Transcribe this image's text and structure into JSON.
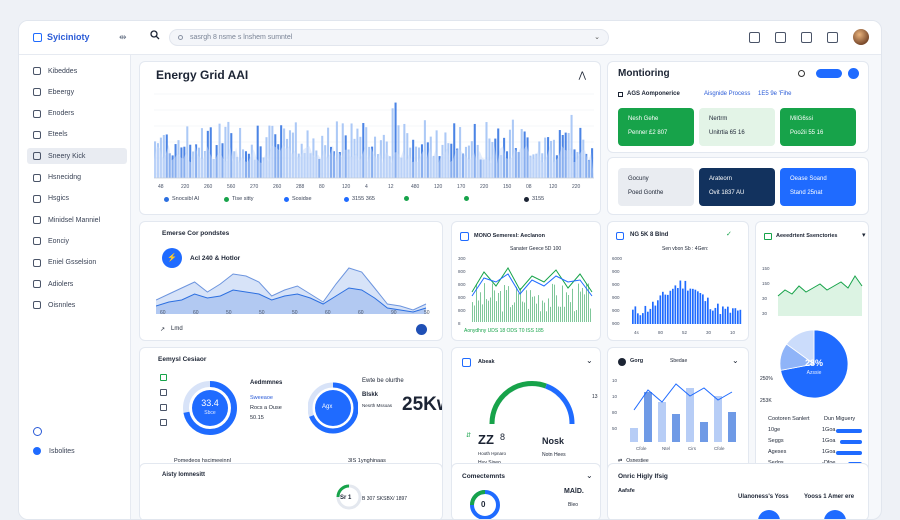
{
  "app": {
    "brand": "Syicinioty"
  },
  "search": {
    "placeholder": "sasrgh 8 nsme s lnshem sumntel"
  },
  "sidebar": {
    "items": [
      {
        "label": "Kibeddes",
        "active": false
      },
      {
        "label": "Ebeergy",
        "active": false
      },
      {
        "label": "Enoders",
        "active": false
      },
      {
        "label": "Eteels",
        "active": false
      },
      {
        "label": "Sneery Kick",
        "active": true
      },
      {
        "label": "Hsnecidng",
        "active": false
      },
      {
        "label": "Hsgics",
        "active": false
      },
      {
        "label": "Minidsel Manniel",
        "active": false
      },
      {
        "label": "Eonciy",
        "active": false
      },
      {
        "label": "Eniel Gsselsion",
        "active": false
      },
      {
        "label": "Adiolers",
        "active": false
      },
      {
        "label": "Oisnnles",
        "active": false
      }
    ],
    "bottom_label": "Isbolites"
  },
  "energy_card": {
    "title": "Energy Grid AAI",
    "x_ticks": [
      "48",
      "220",
      "260",
      "560",
      "270",
      "260",
      "288",
      "80",
      "120",
      "4",
      "12",
      "480",
      "120",
      "170",
      "220",
      "150",
      "08",
      "120",
      "220"
    ],
    "legend": [
      {
        "label": "Snocsibl AI",
        "color": "#2c6fe0"
      },
      {
        "label": "Tise sitty",
        "color": "#17a34a"
      },
      {
        "label": "Sosidse",
        "color": "#1f6bff"
      },
      {
        "label": "3155 365",
        "color": "#1f6bff"
      },
      {
        "label": "",
        "color": "#17a34a"
      },
      {
        "label": "",
        "color": "#17a34a"
      },
      {
        "label": "3155",
        "color": "#1c2434"
      }
    ]
  },
  "monitoring": {
    "title": "Montioring",
    "button_label": "",
    "sub1": "AGS Aomponerice",
    "sub2": "Aisgnide Process",
    "sub3": "1E5 9e 'Fihe",
    "tiles_row1": [
      {
        "l1": "Nesh Gehe",
        "l2": "Penner £2 807"
      },
      {
        "l1": "Nertrm",
        "l2": "Unitrtia 65 16"
      },
      {
        "l1": "MilG6ssi",
        "l2": "Poo2ii 55 16"
      }
    ],
    "tiles_row2": [
      {
        "l1": "Gocuny",
        "l2": "Poed Gonthe"
      },
      {
        "l1": "Arateorn",
        "l2": "Ovit 1837 AU"
      },
      {
        "l1": "Oease Soand",
        "l2": "Stand 25nat"
      }
    ]
  },
  "area_card": {
    "title": "Emerse Cor pondstes",
    "label": "Acl 240 & Hotlor",
    "x_ticks": [
      "60",
      "60",
      "50",
      "50",
      "50",
      "60",
      "60",
      "90",
      "50"
    ],
    "foot": "Lmd"
  },
  "line_card": {
    "title": "MONO Semeresl: Aeclanon",
    "subtitle": "Sanater Geece 5D 100",
    "y_ticks": [
      "300",
      "800",
      "800",
      "800",
      "800",
      "8"
    ],
    "legend": "Aonydhny UDS 18 ODS T0 ISS 185"
  },
  "bar_card": {
    "title": "NG 5K 8 Blnd",
    "subtitle": "Sen vbon Sb : 4Gen:",
    "y_ticks": [
      "6000",
      "900",
      "900",
      "900",
      "900",
      "900"
    ],
    "x_ticks": [
      "4s",
      "80",
      "52",
      "30",
      "10"
    ]
  },
  "pie_card": {
    "title": "Aeeedrtent Ssenctories",
    "y_ticks": [
      "150",
      "150",
      "30",
      "30"
    ],
    "center_value": "28%",
    "center_label": "Azssie",
    "center_sub": "",
    "side_labels": [
      "250%",
      "253K"
    ],
    "stats": [
      {
        "label": "Cootoren Sanlert",
        "value": "Dun Miguery"
      },
      {
        "label": "10ge",
        "value": "1Goa"
      },
      {
        "label": "Seggs",
        "value": "1Goa"
      },
      {
        "label": "Ageses",
        "value": "1Goa"
      },
      {
        "label": "Sedgs",
        "value": "-Dfoe"
      },
      {
        "label": "",
        "value": "1Gtp"
      }
    ]
  },
  "donut_card": {
    "title": "Eemysl Cesiaor",
    "d1_value": "33.4",
    "d1_sub": "Sbce",
    "d1_label": "Aedmmnes",
    "d1_lines": [
      "Sweeaoe",
      "Rocs a Ouse",
      "50.15"
    ],
    "d2_label": "Agx",
    "big_label": "Ewte be olurthe",
    "big_sub": "Blskk",
    "big_value": "25Kw",
    "mid_line": "Nesrth Mssoas",
    "bottom": "Pomedeos hscimeeinnl",
    "bottom2": "3IS 1ynghinaas",
    "side_ticks": [
      "1",
      "1",
      "1",
      "1"
    ]
  },
  "gauge_card": {
    "title": "Abeak",
    "value": "ZZ",
    "value2": "8",
    "sub": "Hooth Hpnaro",
    "foot": "Huy Siseo",
    "right_title": "Nosk",
    "right_sub": "Notn Hees",
    "right_pct": "13"
  },
  "small_bar_card": {
    "title": "Gorg",
    "subtitle": "Sbedae",
    "y_ticks": [
      "10",
      "10",
      "80",
      "50"
    ],
    "x_ticks": [
      "Cfole",
      "Ntel",
      "Cirs",
      "Cfole"
    ],
    "foot": "Osnestiee"
  },
  "bottom_cards": {
    "c1_title": "Aisty Iomnesitt",
    "c1_line": "B 307 SKSBX/ 1897",
    "c1_sub": "Sr 1",
    "c2_title": "Comectemnts",
    "c2_value": "0",
    "c2_side": "MAlD.",
    "c2_sub": "Bleo",
    "c3_title": "Onric Higly Ifsig",
    "c3_sub": "Aafsfe",
    "c3_col1": "Ulanoness's Yoss",
    "c3_col2": "Yooss 1 Amer ere"
  }
}
